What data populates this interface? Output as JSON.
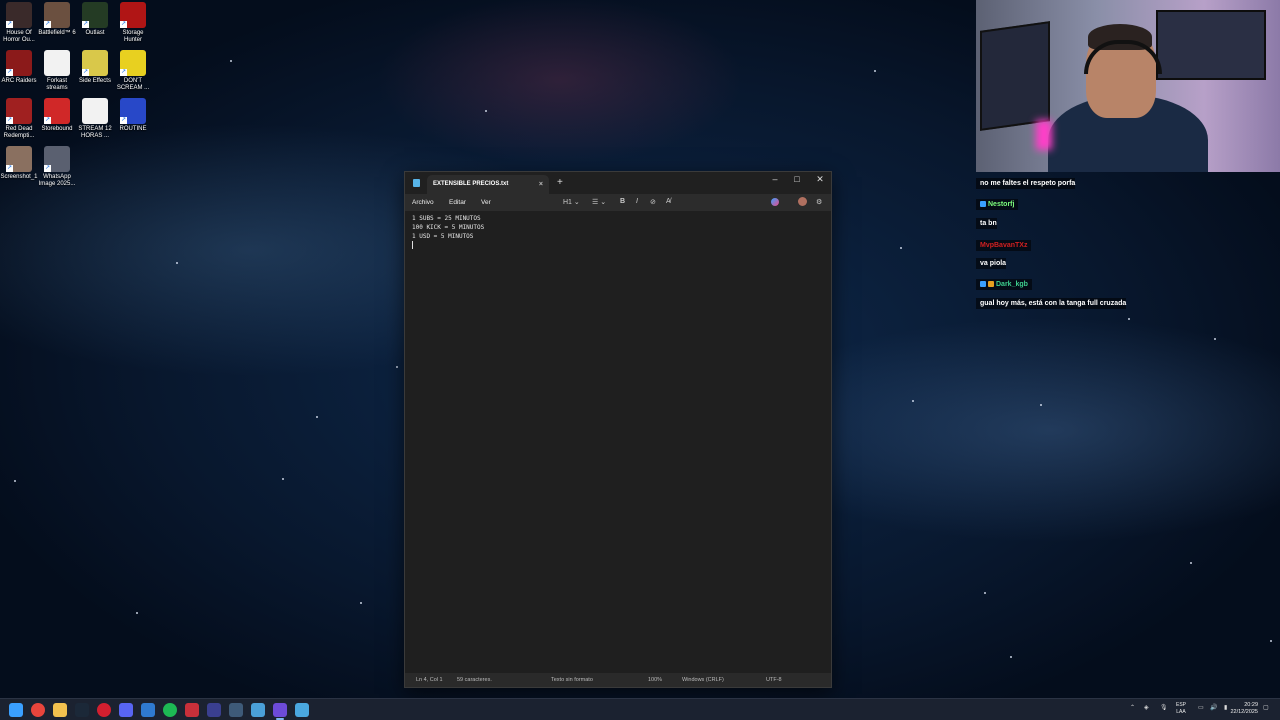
{
  "desktop": {
    "icons": [
      {
        "label": "House Of Horror Ou...",
        "icon": "house-of-horror-icon",
        "color": "#3a2a2a"
      },
      {
        "label": "Battlefield™ 6",
        "icon": "battlefield-icon",
        "color": "#6b5040"
      },
      {
        "label": "Outlast",
        "icon": "outlast-icon",
        "color": "#243b24"
      },
      {
        "label": "Storage Hunter",
        "icon": "storage-hunter-icon",
        "color": "#b01515"
      },
      {
        "label": "ARC Raiders",
        "icon": "arc-raiders-icon",
        "color": "#8b1a1a"
      },
      {
        "label": "Forkast streams",
        "icon": "text-file-icon",
        "color": "#f2f2f2"
      },
      {
        "label": "Side Effects",
        "icon": "side-effects-icon",
        "color": "#d9c84a"
      },
      {
        "label": "DON'T SCREAM ...",
        "icon": "dont-scream-icon",
        "color": "#e8d020"
      },
      {
        "label": "Red Dead Redempti...",
        "icon": "red-dead-icon",
        "color": "#a02020"
      },
      {
        "label": "Storebound",
        "icon": "storebound-icon",
        "color": "#d02828"
      },
      {
        "label": "STREAM 12 HORAS ...",
        "icon": "text-file-icon",
        "color": "#f2f2f2"
      },
      {
        "label": "ROUTINE",
        "icon": "routine-icon",
        "color": "#2848c8"
      },
      {
        "label": "Screenshot_1",
        "icon": "image-file-icon",
        "color": "#8a7060"
      },
      {
        "label": "WhatsApp Image 2025...",
        "icon": "image-file-icon",
        "color": "#5a6070"
      }
    ]
  },
  "notepad": {
    "tab_title": "EXTENSIBLE PRECIOS.txt",
    "tab_close": "×",
    "new_tab": "+",
    "window_controls": {
      "minimize": "–",
      "maximize": "□",
      "close": "✕"
    },
    "menu": {
      "file": "Archivo",
      "edit": "Editar",
      "view": "Ver"
    },
    "toolbar": {
      "heading": "H1 ⌄",
      "list": "☰ ⌄",
      "bold": "B",
      "italic": "I",
      "link": "⊘",
      "clear": "A̸"
    },
    "lines": [
      "1 SUBS = 25 MINUTOS",
      "100 KICK = 5 MINUTOS",
      "1 USD = 5 MINUTOS"
    ],
    "status": {
      "position": "Ln 4, Col 1",
      "chars": "59 caracteres.",
      "format": "Texto sin formato",
      "zoom": "100%",
      "line_ending": "Windows (CRLF)",
      "encoding": "UTF-8"
    }
  },
  "chat": {
    "lines": [
      {
        "user": "",
        "text": "no me faltes el respeto porfa",
        "color": ""
      },
      {
        "user": "Nestorfj",
        "text": "ta bn",
        "color": "#7cfc7c"
      },
      {
        "user": "MvpBavanTXz",
        "text": "va piola",
        "color": "#d02020"
      },
      {
        "user": "Dark_kgb",
        "text": "gual hoy más, está con la tanga full cruzada",
        "color": "#3ecf8e"
      }
    ]
  },
  "taskbar": {
    "apps": [
      {
        "icon": "windows-start-icon",
        "color": "#3aa0ff"
      },
      {
        "icon": "chrome-icon",
        "color": "#e8453c"
      },
      {
        "icon": "file-explorer-icon",
        "color": "#f2c14e"
      },
      {
        "icon": "steam-icon",
        "color": "#1b2838"
      },
      {
        "icon": "opera-icon",
        "color": "#d21f2f"
      },
      {
        "icon": "discord-icon",
        "color": "#5865f2"
      },
      {
        "icon": "remote-desktop-icon",
        "color": "#2f7ad0"
      },
      {
        "icon": "spotify-icon",
        "color": "#1db954"
      },
      {
        "icon": "streamlabs-icon",
        "color": "#c8303a"
      },
      {
        "icon": "app-launcher-icon",
        "color": "#3a3f8f"
      },
      {
        "icon": "vpn-icon",
        "color": "#3e5a78"
      },
      {
        "icon": "network-app-icon",
        "color": "#4aa0d8"
      },
      {
        "icon": "twitch-studio-icon",
        "color": "#6c4bd8"
      },
      {
        "icon": "notepad-icon",
        "color": "#4aa8e0"
      }
    ],
    "lang_top": "ESP",
    "lang_bottom": "LAA",
    "time": "20:29",
    "date": "22/12/2025"
  }
}
